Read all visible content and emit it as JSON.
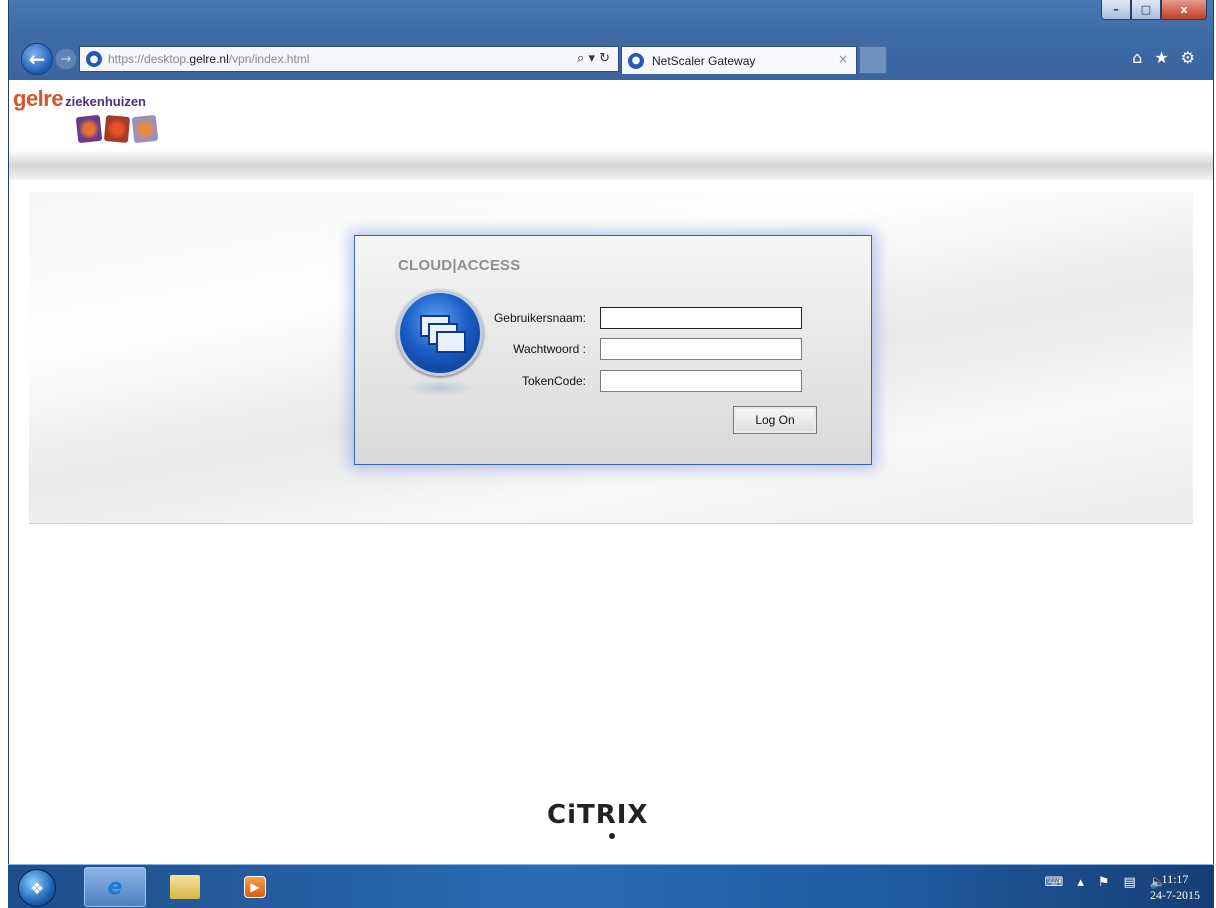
{
  "window": {
    "minimize_label": "–",
    "maximize_label": "□",
    "close_label": "x"
  },
  "browser": {
    "url_prefix": "https://desktop.",
    "url_domain": "gelre.nl",
    "url_path": "/vpn/index.html",
    "address_tools": "⌕ ▾ ↻",
    "tab_title": "NetScaler Gateway",
    "tab_close": "×",
    "back_label": "←",
    "forward_label": "→",
    "home_icon": "⌂",
    "favorites_icon": "★",
    "tools_icon": "⚙"
  },
  "logo": {
    "word": "gelre",
    "sub": "ziekenhuizen"
  },
  "login": {
    "brand": "CLOUD|ACCESS",
    "fields": [
      {
        "label": "Gebruikersnaam:",
        "value": ""
      },
      {
        "label": "Wachtwoord :",
        "value": ""
      },
      {
        "label": "TokenCode:",
        "value": ""
      }
    ],
    "logon_label": "Log On"
  },
  "footer": {
    "logo": "CiTRIX"
  },
  "taskbar": {
    "ie_label": "e",
    "clock_time": "11:17",
    "clock_date": "24-7-2015",
    "tray_icons": [
      "keyboard-icon",
      "show-hidden-icon",
      "flag-icon",
      "network-icon",
      "volume-icon"
    ]
  },
  "colors": {
    "chrome_blue": "#3f6ba7",
    "panel_border": "#3b63a8",
    "logo_orange": "#d9532a",
    "logo_purple": "#4b2f7a"
  }
}
